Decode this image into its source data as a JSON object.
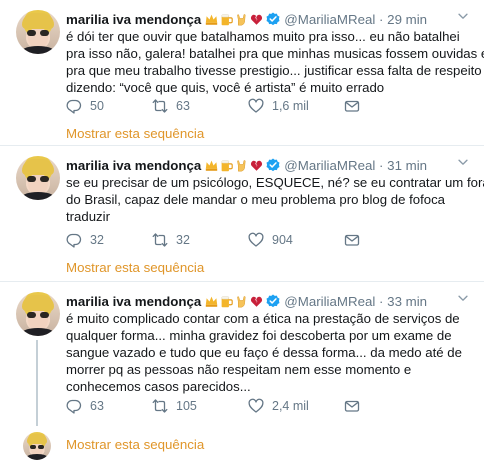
{
  "tweets": [
    {
      "name": "marilia iva mendonça",
      "handle": "@MariliaMReal",
      "time": "· 29 min",
      "lines": [
        "é dói ter que ouvir que batalhamos muito pra isso... eu não batalhei",
        "pra isso não, galera! batalhei pra que minhas musicas fossem ouvidas e",
        "pra que meu trabalho tivesse prestigio... justificar essa falta de respeito",
        "dizendo: “você que quis, você é artista” é muito errado"
      ],
      "replies": "50",
      "retweets": "63",
      "likes": "1,6 mil",
      "thread_label": "Mostrar esta sequência"
    },
    {
      "name": "marilia iva mendonça",
      "handle": "@MariliaMReal",
      "time": "· 31 min",
      "lines": [
        "se eu precisar de um psicólogo, ESQUECE, né? se eu contratar um fora",
        "do Brasil, capaz dele mandar o meu problema pro blog de fofoca",
        "traduzir"
      ],
      "replies": "32",
      "retweets": "32",
      "likes": "904",
      "thread_label": "Mostrar esta sequência"
    },
    {
      "name": "marilia iva mendonça",
      "handle": "@MariliaMReal",
      "time": "· 33 min",
      "lines": [
        "é muito complicado contar com a ética na prestação de serviços de",
        "qualquer forma... minha gravidez foi descoberta por um exame de",
        "sangue vazado e tudo que eu faço é dessa forma... da medo até de",
        "morrer pq as pessoas não respeitam nem esse momento e",
        "conhecemos casos parecidos..."
      ],
      "replies": "63",
      "retweets": "105",
      "likes": "2,4 mil",
      "thread_label": "Mostrar esta sequência"
    }
  ],
  "icons": {
    "emojis": [
      "crown-emoji",
      "beer-emoji",
      "rock-hand-emoji",
      "broken-heart-emoji"
    ],
    "verified": "verified-badge-icon",
    "caret": "chevron-down-icon",
    "reply": "reply-icon",
    "retweet": "retweet-icon",
    "like": "heart-icon",
    "dm": "envelope-icon"
  },
  "colors": {
    "link": "#e0962a",
    "muted": "#657786",
    "verified": "#1da1f2",
    "divider": "#e6ecf0"
  }
}
